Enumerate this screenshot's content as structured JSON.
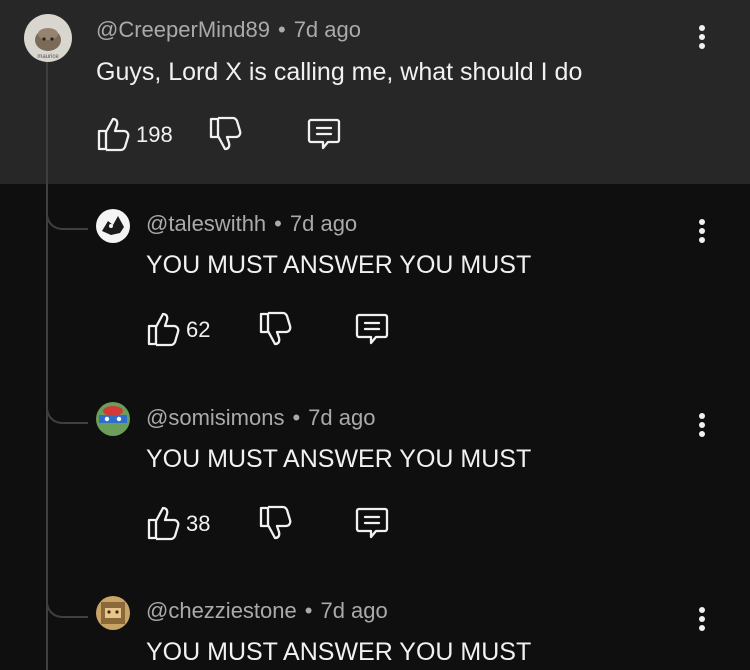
{
  "comments": [
    {
      "handle": "@CreeperMind89",
      "time": "7d ago",
      "text": "Guys, Lord X is calling me, what should I do",
      "likes": "198",
      "avatar_label": "maurice"
    },
    {
      "handle": "@taleswithh",
      "time": "7d ago",
      "text": "YOU MUST ANSWER YOU MUST",
      "likes": "62"
    },
    {
      "handle": "@somisimons",
      "time": "7d ago",
      "text": "YOU MUST ANSWER YOU MUST",
      "likes": "38"
    },
    {
      "handle": "@chezziestone",
      "time": "7d ago",
      "text": "YOU MUST ANSWER YOU MUST"
    }
  ],
  "separator": "•",
  "icons": {
    "like": "thumbs-up-icon",
    "dislike": "thumbs-down-icon",
    "reply": "comment-icon",
    "more": "more-vertical-icon"
  },
  "colors": {
    "background": "#0f0f0f",
    "highlight": "#272727",
    "text": "#f1f1f1",
    "muted": "#aaaaaa"
  }
}
